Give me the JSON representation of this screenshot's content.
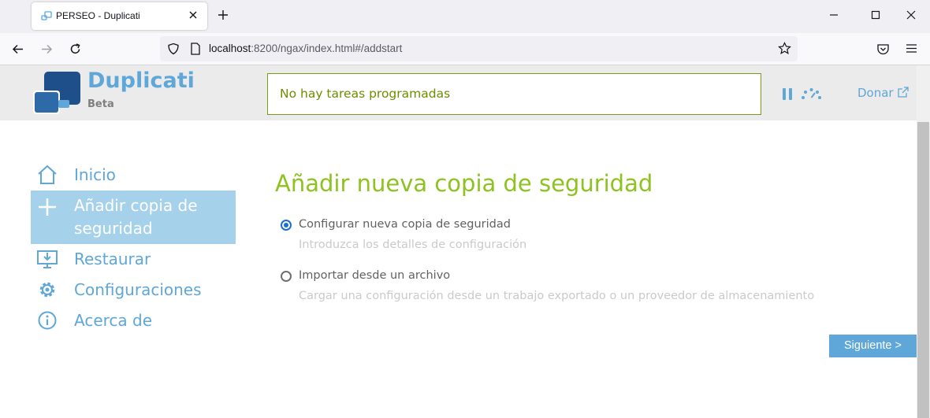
{
  "browser": {
    "tab_title": "PERSEO - Duplicati",
    "url_host": "localhost",
    "url_rest": ":8200/ngax/index.html#/addstart"
  },
  "header": {
    "brand": "Duplicati",
    "brand_sub": "Beta",
    "status": "No hay tareas programadas",
    "donate": "Donar"
  },
  "sidebar": {
    "items": [
      {
        "label": "Inicio",
        "icon": "home-icon"
      },
      {
        "label": "Añadir copia de seguridad",
        "icon": "plus-icon",
        "active": true
      },
      {
        "label": "Restaurar",
        "icon": "restore-icon"
      },
      {
        "label": "Configuraciones",
        "icon": "gear-icon"
      },
      {
        "label": "Acerca de",
        "icon": "info-icon"
      }
    ]
  },
  "main": {
    "title": "Añadir nueva copia de seguridad",
    "options": [
      {
        "label": "Configurar nueva copia de seguridad",
        "description": "Introduzca los detalles de configuración",
        "checked": true
      },
      {
        "label": "Importar desde un archivo",
        "description": "Cargar una configuración desde un trabajo exportado o un proveedor de almacenamiento",
        "checked": false
      }
    ],
    "next_label": "Siguiente >"
  },
  "colors": {
    "accent_blue": "#5ea7d8",
    "accent_green": "#8dc21f",
    "active_bg": "#a6d1eb"
  }
}
